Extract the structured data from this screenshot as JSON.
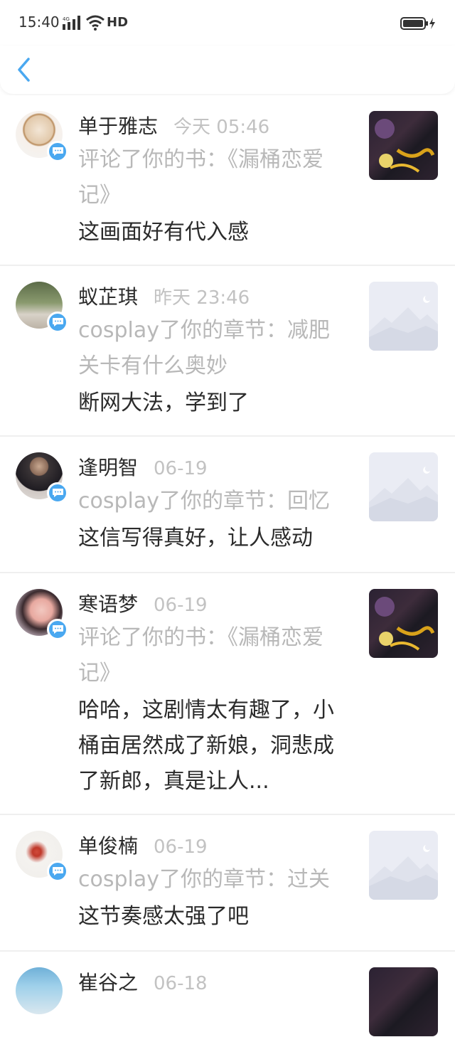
{
  "status": {
    "time": "15:40",
    "network": "HD"
  },
  "items": [
    {
      "name": "单于雅志",
      "time": "今天 05:46",
      "source": "评论了你的书：《漏桶恋爱记》",
      "comment": "这画面好有代入感"
    },
    {
      "name": "蚁芷琪",
      "time": "昨天 23:46",
      "source": "cosplay了你的章节：减肥关卡有什么奥妙",
      "comment": "断网大法，学到了"
    },
    {
      "name": "逢明智",
      "time": "06-19",
      "source": "cosplay了你的章节：回忆",
      "comment": "这信写得真好，让人感动"
    },
    {
      "name": "寒语梦",
      "time": "06-19",
      "source": "评论了你的书：《漏桶恋爱记》",
      "comment": "哈哈，这剧情太有趣了，小桶亩居然成了新娘，洞悲成了新郎，真是让人..."
    },
    {
      "name": "单俊楠",
      "time": "06-19",
      "source": "cosplay了你的章节：过关",
      "comment": "这节奏感太强了吧"
    },
    {
      "name": "崔谷之",
      "time": "06-18",
      "source": "",
      "comment": ""
    }
  ],
  "colors": {
    "accent": "#4aa8f0",
    "muted": "#b8b8b8",
    "text": "#2b2b2b"
  }
}
